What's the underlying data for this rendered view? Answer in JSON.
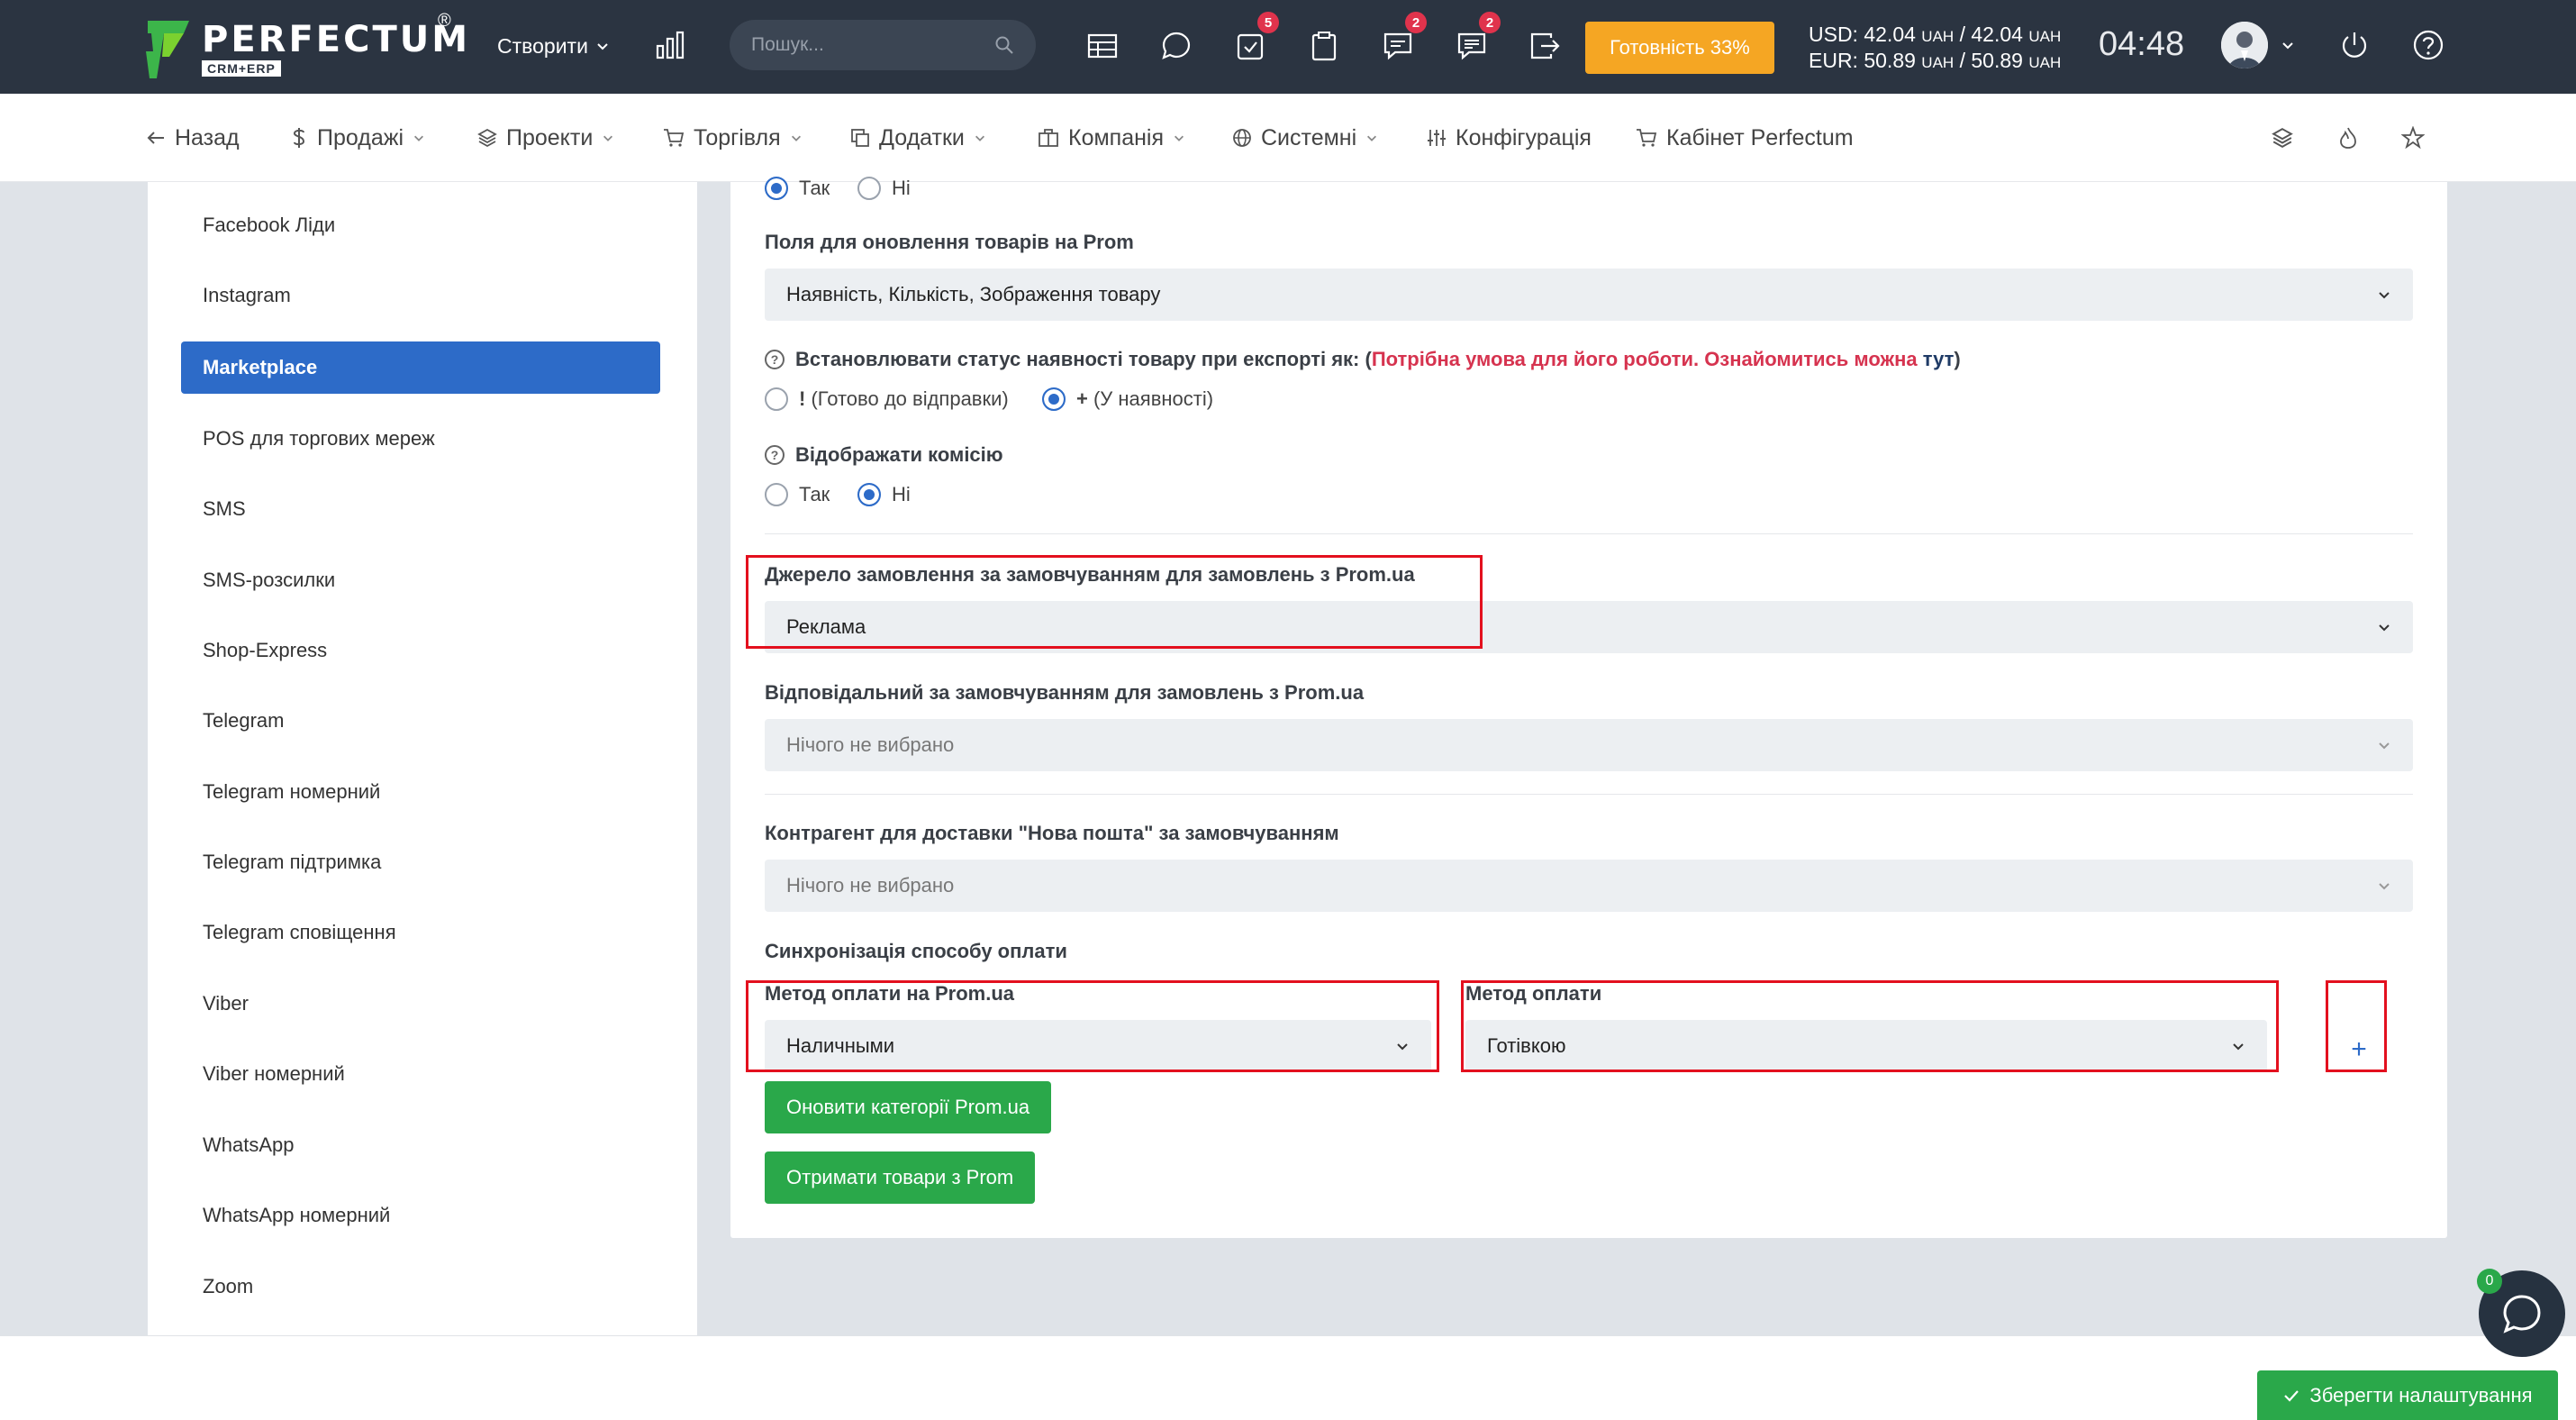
{
  "topbar": {
    "logo_text": "PERFECTUM",
    "logo_sub": "CRM+ERP",
    "logo_reg": "®",
    "create_label": "Створити",
    "search_placeholder": "Пошук...",
    "badges": {
      "tasks": "5",
      "messages": "2",
      "chat": "2"
    },
    "readiness_label": "Готовність 33%",
    "currency": {
      "usd_prefix": "USD: 42.04",
      "usd_unit1": "UAH",
      "usd_mid": " / 42.04",
      "usd_unit2": "UAH",
      "eur_prefix": "EUR: 50.89",
      "eur_unit1": "UAH",
      "eur_mid": " / 50.89",
      "eur_unit2": "UAH"
    },
    "clock": "04:48"
  },
  "navbar": {
    "back": "Назад",
    "sales": "Продажі",
    "projects": "Проекти",
    "trade": "Торгівля",
    "addons": "Додатки",
    "company": "Компанія",
    "system": "Системні",
    "config": "Конфігурація",
    "cabinet": "Кабінет Perfectum"
  },
  "sidebar": {
    "items": [
      {
        "label": "Facebook Ліди"
      },
      {
        "label": "Instagram"
      },
      {
        "label": "Marketplace"
      },
      {
        "label": "POS для торгових мереж"
      },
      {
        "label": "SMS"
      },
      {
        "label": "SMS-розсилки"
      },
      {
        "label": "Shop-Express"
      },
      {
        "label": "Telegram"
      },
      {
        "label": "Telegram номерний"
      },
      {
        "label": "Telegram підтримка"
      },
      {
        "label": "Telegram сповіщення"
      },
      {
        "label": "Viber"
      },
      {
        "label": "Viber номерний"
      },
      {
        "label": "WhatsApp"
      },
      {
        "label": "WhatsApp номерний"
      },
      {
        "label": "Zoom"
      }
    ]
  },
  "form": {
    "top_radio": {
      "yes": "Так",
      "no": "Ні"
    },
    "update_fields_label": "Поля для оновлення товарів на Prom",
    "update_fields_value": "Наявність, Кількість, Зображення товару",
    "stock_status_label": "Встановлювати статус наявності товару при експорті як: (",
    "stock_status_warning": "Потрібна умова для його роботи. Ознайомитись можна",
    "stock_status_link": "тут",
    "stock_status_close": ")",
    "stock_opt1_sym": "!",
    "stock_opt1": "(Готово до відправки)",
    "stock_opt2_sym": "+",
    "stock_opt2": "(У наявності)",
    "commission_label": "Відображати комісію",
    "commission_yes": "Так",
    "commission_no": "Ні",
    "source_label": "Джерело замовлення за замовчуванням для замовлень з Prom.ua",
    "source_value": "Реклама",
    "responsible_label": "Відповідальний за замовчуванням для замовлень з Prom.ua",
    "responsible_value": "Нічого не вибрано",
    "contractor_label": "Контрагент для доставки \"Нова пошта\" за замовчуванням",
    "contractor_value": "Нічого не вибрано",
    "payment_sync_label": "Синхронізація способу оплати",
    "prom_method_label": "Метод оплати на Prom.ua",
    "prom_method_value": "Наличными",
    "method_label": "Метод оплати",
    "method_value": "Готівкою",
    "add_symbol": "+",
    "update_categories_btn": "Оновити категорії Prom.ua",
    "get_products_btn": "Отримати товари з Prom"
  },
  "footer": {
    "save_label": "Зберегти налаштування",
    "chat_badge": "0"
  },
  "colors": {
    "topbar": "#2b3441",
    "accent_blue": "#2d6bc8",
    "green": "#2aa84a",
    "orange": "#f5a623",
    "warning_red": "#d6334f",
    "highlight_red": "#e3101e"
  }
}
